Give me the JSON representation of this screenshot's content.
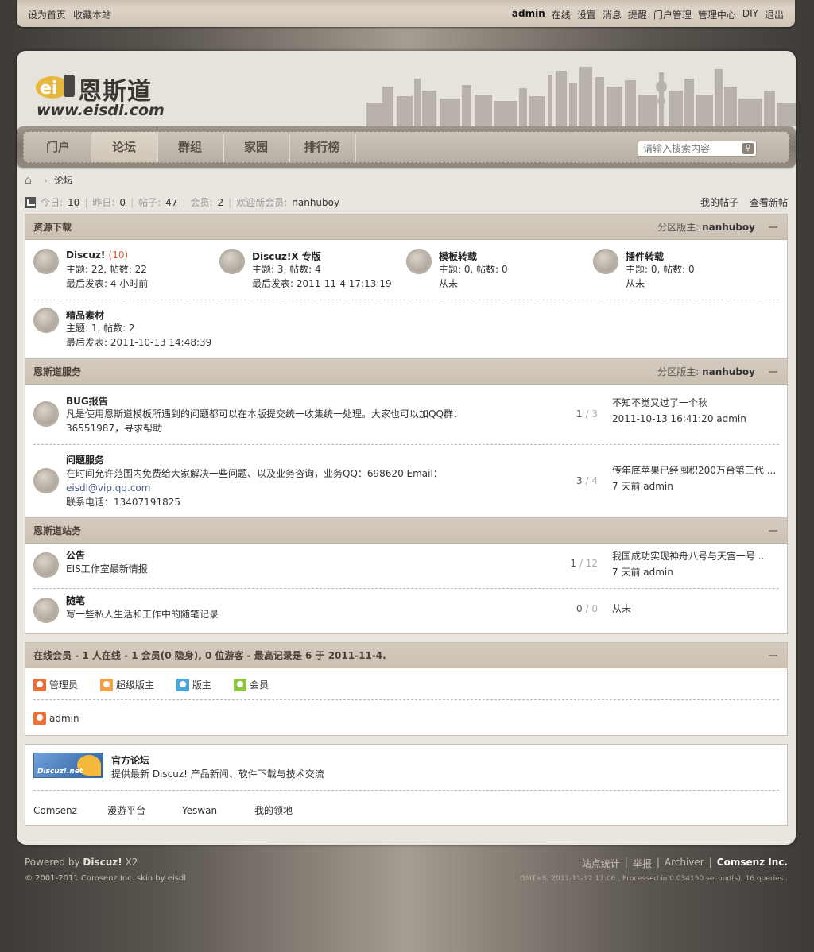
{
  "topbar": {
    "left": [
      "设为首页",
      "收藏本站"
    ],
    "user": "admin",
    "right": [
      "在线",
      "设置",
      "消息",
      "提醒",
      "门户管理",
      "管理中心",
      "DIY",
      "退出"
    ]
  },
  "logo": {
    "cn": "恩斯道",
    "en": "www.eisdl.com"
  },
  "nav": {
    "items": [
      "门户",
      "论坛",
      "群组",
      "家园",
      "排行榜"
    ],
    "active": "论坛"
  },
  "search": {
    "placeholder": "请输入搜索内容"
  },
  "breadcrumb": {
    "current": "论坛"
  },
  "stats": {
    "today_label": "今日:",
    "today": "10",
    "yesterday_label": "昨日:",
    "yesterday": "0",
    "posts_label": "帖子:",
    "posts": "47",
    "members_label": "会员:",
    "members": "2",
    "newmember_label": "欢迎新会员:",
    "newmember": "nanhuboy"
  },
  "quick": [
    "我的帖子",
    "查看新帖"
  ],
  "cat1": {
    "title": "资源下载",
    "mod_label": "分区版主:",
    "mod": "nanhuboy",
    "forums": [
      {
        "name": "Discuz!",
        "new": "(10)",
        "l1": "主题: 22, 帖数: 22",
        "l2": "最后发表: 4 小时前"
      },
      {
        "name": "Discuz!X 专版",
        "new": "",
        "l1": "主题: 3, 帖数: 4",
        "l2": "最后发表: 2011-11-4 17:13:19"
      },
      {
        "name": "模板转载",
        "new": "",
        "l1": "主题: 0, 帖数: 0",
        "l2": "从未"
      },
      {
        "name": "插件转载",
        "new": "",
        "l1": "主题: 0, 帖数: 0",
        "l2": "从未"
      },
      {
        "name": "精品素材",
        "new": "",
        "l1": "主题: 1, 帖数: 2",
        "l2": "最后发表: 2011-10-13 14:48:39"
      }
    ]
  },
  "cat2": {
    "title": "恩斯道服务",
    "mod_label": "分区版主:",
    "mod": "nanhuboy",
    "forums": [
      {
        "name": "BUG报告",
        "desc1": "凡是使用恩斯道模板所遇到的问题都可以在本版提交统一收集统一处理。大家也可以加QQ群：",
        "desc2": "36551987，寻求帮助",
        "threads": "1",
        "posts": "3",
        "last_title": "不知不觉又过了一个秋",
        "last_info": "2011-10-13 16:41:20 admin"
      },
      {
        "name": "问题服务",
        "desc1": "在时间允许范围内免费给大家解决一些问题、以及业务咨询，业务QQ：698620 Email：",
        "desc2": "eisdl@vip.qq.com",
        "desc3": "联系电话：13407191825",
        "threads": "3",
        "posts": "4",
        "last_title": "传年底苹果已经囤积200万台第三代 ...",
        "last_info": "7 天前 admin"
      }
    ]
  },
  "cat3": {
    "title": "恩斯道站务",
    "forums": [
      {
        "name": "公告",
        "desc": "EIS工作室最新情报",
        "threads": "1",
        "posts": "12",
        "last_title": "我国成功实现神舟八号与天宫一号 ...",
        "last_info": "7 天前 admin"
      },
      {
        "name": "随笔",
        "desc": "写一些私人生活和工作中的随笔记录",
        "threads": "0",
        "posts": "0",
        "last_title": "从未",
        "last_info": ""
      }
    ]
  },
  "online": {
    "title": "在线会员 - 1 人在线 - 1 会员(0 隐身), 0 位游客 - 最高记录是 6 于 2011-11-4.",
    "legend": [
      {
        "label": "管理员",
        "color": "#e8703a"
      },
      {
        "label": "超级版主",
        "color": "#f0a040"
      },
      {
        "label": "版主",
        "color": "#4aa6dc"
      },
      {
        "label": "会员",
        "color": "#8cc63f"
      }
    ],
    "users": [
      "admin"
    ]
  },
  "links": {
    "logo_text": "Discuz!.net",
    "title": "官方论坛",
    "desc": "提供最新 Discuz! 产品新闻、软件下载与技术交流",
    "items": [
      "Comsenz",
      "漫游平台",
      "Yeswan",
      "我的领地"
    ]
  },
  "footer": {
    "powered_pre": "Powered by",
    "powered": "Discuz!",
    "powered_ver": "X2",
    "copyright": "© 2001-2011 Comsenz Inc. skin by eisdl",
    "links": [
      "站点统计",
      "举报",
      "Archiver"
    ],
    "company": "Comsenz Inc.",
    "gmt": "GMT+8, 2011-11-12 17:06 , Processed in 0.034150 second(s), 16 queries ."
  }
}
